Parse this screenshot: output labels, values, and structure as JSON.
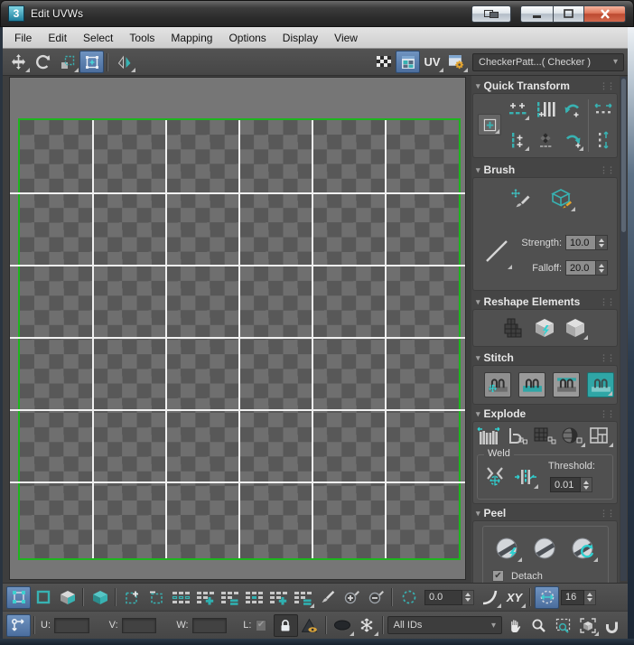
{
  "window": {
    "title": "Edit UVWs",
    "app_badge": "3"
  },
  "menu": {
    "items": [
      "File",
      "Edit",
      "Select",
      "Tools",
      "Mapping",
      "Options",
      "Display",
      "View"
    ]
  },
  "top_toolbar": {
    "uv_label": "UV",
    "texture_selector_value": "CheckerPatt...( Checker )"
  },
  "panels": {
    "quick_transform": {
      "title": "Quick Transform"
    },
    "brush": {
      "title": "Brush",
      "strength_label": "Strength:",
      "strength_value": "10.0",
      "falloff_label": "Falloff:",
      "falloff_value": "20.0"
    },
    "reshape_elements": {
      "title": "Reshape Elements"
    },
    "stitch": {
      "title": "Stitch"
    },
    "explode": {
      "title": "Explode",
      "weld_group_label": "Weld",
      "threshold_label": "Threshold:",
      "threshold_value": "0.01"
    },
    "peel": {
      "title": "Peel",
      "detach_label": "Detach",
      "detach_checked": true
    }
  },
  "selection_bar": {
    "soft_selection_value": "0.0",
    "axis_space_label": "XY",
    "paint_size_value": "16"
  },
  "status_bar": {
    "u_label": "U:",
    "u_value": "",
    "v_label": "V:",
    "v_value": "",
    "w_label": "W:",
    "w_value": "",
    "l_label": "L:",
    "material_id_filter": "All IDs"
  },
  "canvas": {
    "grid_columns": 6,
    "grid_rows": 6
  },
  "glyphs": {
    "dropdown_arrow": "▾",
    "rollout_arrow": "▾",
    "check": "✔",
    "grip": "⋮⋮"
  },
  "colors": {
    "accent_teal": "#38b2b2",
    "selection_blue": "#5a80ad",
    "uv_border_green": "#1db51d",
    "accent_orange": "#e3a42f",
    "canvas_gray": "#767676",
    "checker_light": "#6f6f6f",
    "checker_dark": "#585858"
  },
  "icon_names": [
    "app-icon",
    "dock-window-icon",
    "minimize-icon",
    "maximize-icon",
    "close-icon",
    "move-icon",
    "rotate-icon",
    "scale-icon",
    "freeform-mode-icon",
    "mirror-icon",
    "checker-pattern-icon",
    "show-map-icon",
    "uv-options-icon",
    "render-settings-icon",
    "align-tool-icon",
    "align-horizontal-icon",
    "align-vertical-icon",
    "rotate-ccw-icon",
    "space-horizontal-icon",
    "align-elements-icon",
    "grid-snap-icon",
    "rotate-cw-icon",
    "space-vertical-icon",
    "move-brush-icon",
    "relax-brush-icon",
    "falloff-type-icon",
    "straighten-selection-icon",
    "relax-fast-icon",
    "relax-icon",
    "stitch-custom-icon",
    "stitch-source-icon",
    "stitch-average-icon",
    "stitch-target-icon",
    "break-icon",
    "flatten-by-edge-icon",
    "flatten-by-smoothing-icon",
    "flatten-by-material-icon",
    "flatten-custom-icon",
    "target-weld-icon",
    "weld-selected-icon",
    "quick-peel-icon",
    "peel-mode-icon",
    "reset-peel-icon",
    "vertex-subobject-icon",
    "edge-subobject-icon",
    "polygon-subobject-icon",
    "element-icon",
    "grow-selection-icon",
    "shrink-selection-icon",
    "ring-select-icon",
    "grow-ring-icon",
    "shrink-ring-icon",
    "loop-select-icon",
    "grow-loop-icon",
    "shrink-loop-icon",
    "paint-select-icon",
    "paint-select-add-icon",
    "paint-select-subtract-icon",
    "soft-selection-icon",
    "falloff-curve-icon",
    "paint-soft-selection-icon",
    "absolute-offset-toggle-icon",
    "lock-selection-icon",
    "filter-selected-faces-icon",
    "hide-icon",
    "freeze-icon",
    "pan-icon",
    "zoom-icon",
    "zoom-region-icon",
    "zoom-extents-icon",
    "snap-magnet-icon"
  ]
}
